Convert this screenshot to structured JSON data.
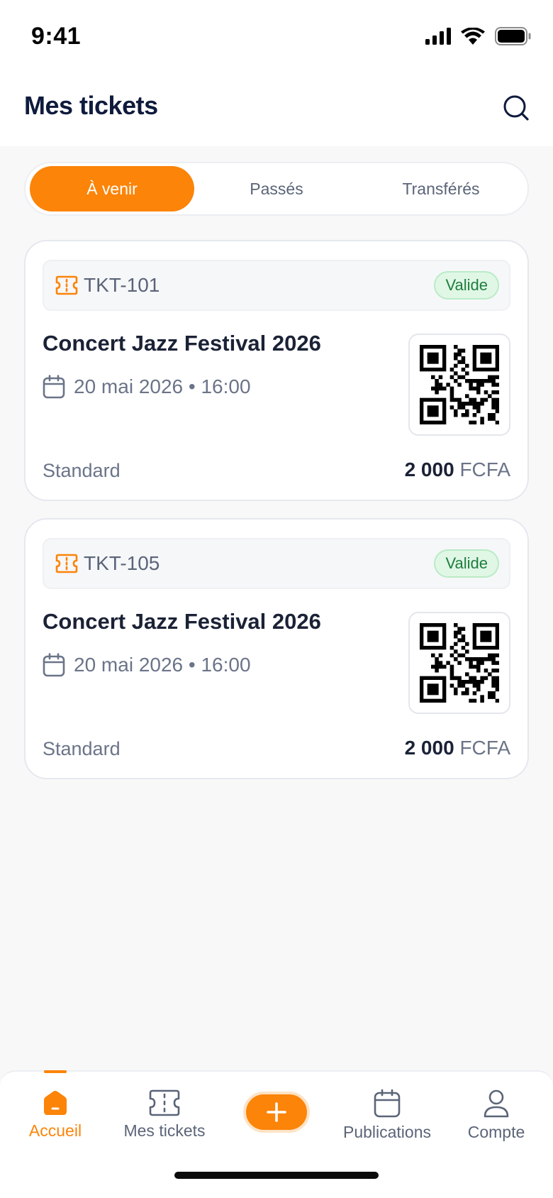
{
  "status_bar": {
    "time": "9:41"
  },
  "header": {
    "title": "Mes tickets"
  },
  "tabs": [
    {
      "label": "À venir",
      "active": true
    },
    {
      "label": "Passés",
      "active": false
    },
    {
      "label": "Transférés",
      "active": false
    }
  ],
  "tickets": [
    {
      "id": "TKT-101",
      "status": "Valide",
      "event": "Concert Jazz Festival 2026",
      "datetime": "20 mai 2026 • 16:00",
      "type": "Standard",
      "price_amount": "2 000",
      "currency": "FCFA"
    },
    {
      "id": "TKT-105",
      "status": "Valide",
      "event": "Concert Jazz Festival 2026",
      "datetime": "20 mai 2026 • 16:00",
      "type": "Standard",
      "price_amount": "2 000",
      "currency": "FCFA"
    }
  ],
  "bottom_nav": {
    "items": [
      {
        "label": "Accueil",
        "icon": "home-icon",
        "active": true
      },
      {
        "label": "Mes tickets",
        "icon": "ticket-icon",
        "active": false
      },
      {
        "label": "",
        "icon": "plus-icon",
        "active": false
      },
      {
        "label": "Publications",
        "icon": "calendar-icon",
        "active": false
      },
      {
        "label": "Compte",
        "icon": "user-icon",
        "active": false
      }
    ]
  },
  "colors": {
    "accent": "#fb8409",
    "success_bg": "#e0f7e6",
    "success_text": "#1e7d3d",
    "title": "#0f1b3d"
  }
}
